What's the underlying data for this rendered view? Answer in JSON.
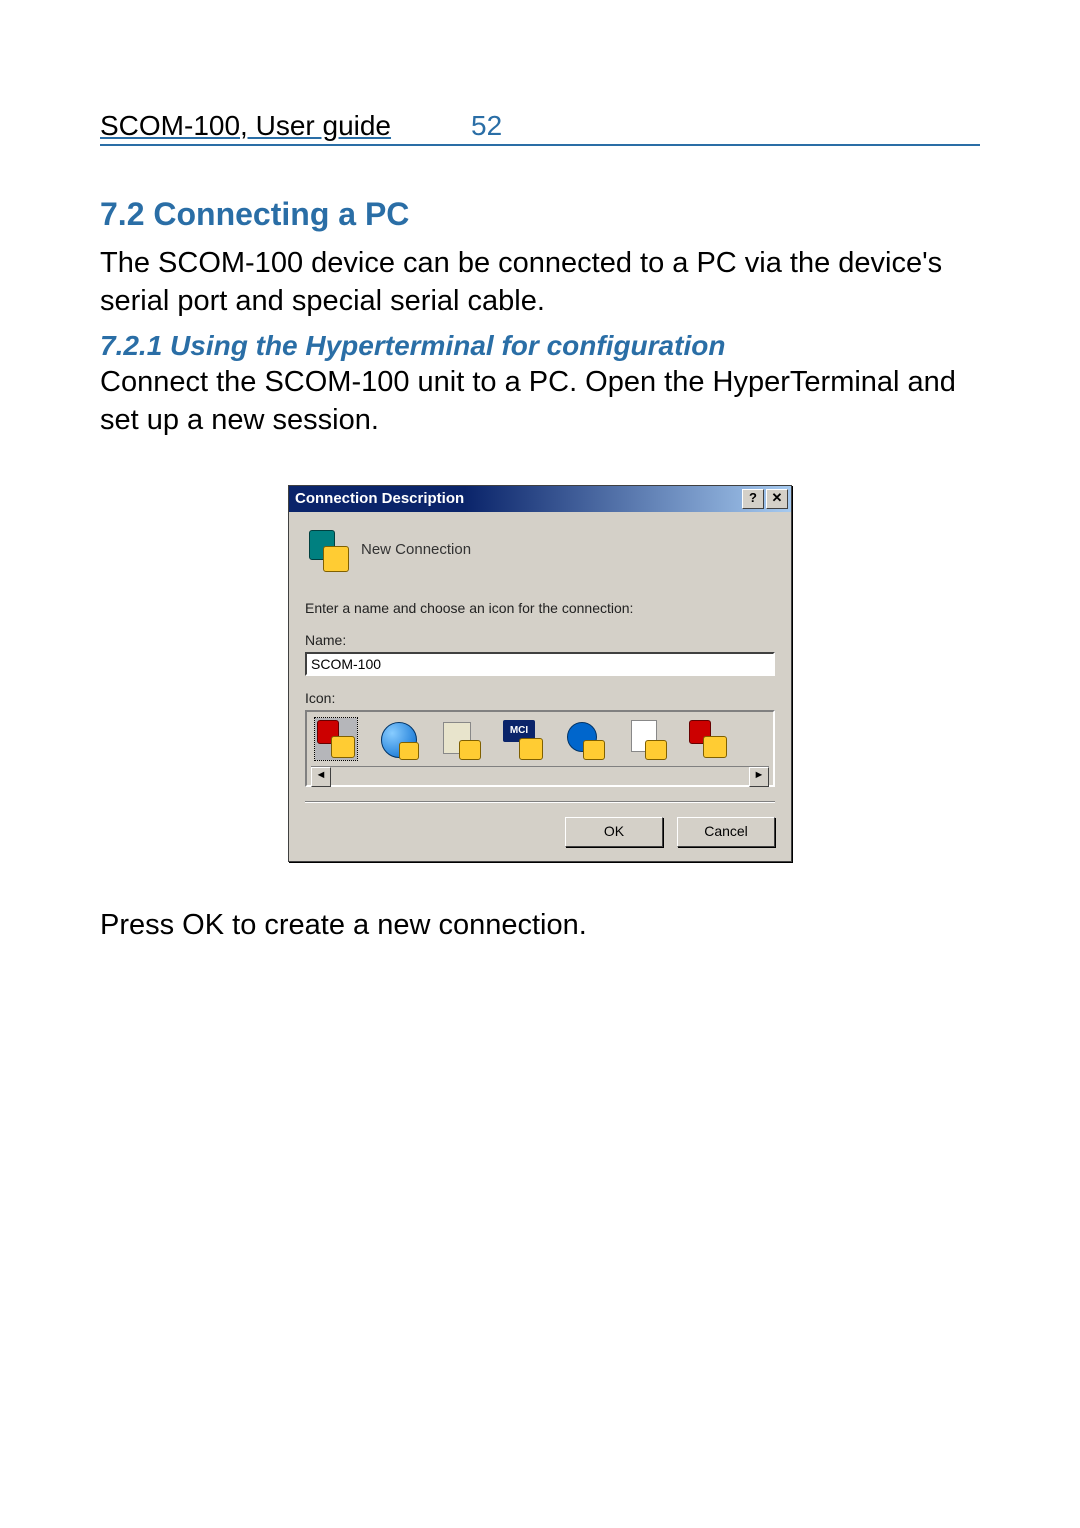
{
  "header": {
    "doc_title": "SCOM-100, User guide",
    "page_number": "52"
  },
  "section": {
    "heading": "7.2 Connecting a PC",
    "intro": "The SCOM-100 device can be connected to a PC via the device's serial port and special serial cable.",
    "sub_heading": "7.2.1 Using the Hyperterminal for configuration",
    "sub_text": "Connect the SCOM-100 unit to a PC. Open the HyperTerminal and set up a new session.",
    "after_dialog": "Press OK to create a new connection."
  },
  "dialog": {
    "title": "Connection Description",
    "help_btn": "?",
    "close_btn": "✕",
    "new_connection_label": "New Connection",
    "instruction": "Enter a name and choose an icon for the connection:",
    "name_label": "Name:",
    "name_value": "SCOM-100",
    "icon_label": "Icon:",
    "icons": [
      {
        "name": "hyperterminal-red-phone-icon",
        "selected": true
      },
      {
        "name": "globe-phone-icon",
        "selected": false
      },
      {
        "name": "building-phone-icon",
        "selected": false
      },
      {
        "name": "mci-phone-icon",
        "selected": false,
        "text": "MCI"
      },
      {
        "name": "dial-phone-icon",
        "selected": false
      },
      {
        "name": "document-phone-icon",
        "selected": false
      },
      {
        "name": "red-phone-icon-2",
        "selected": false
      }
    ],
    "scroll_left": "◄",
    "scroll_right": "►",
    "ok_label": "OK",
    "cancel_label": "Cancel"
  }
}
